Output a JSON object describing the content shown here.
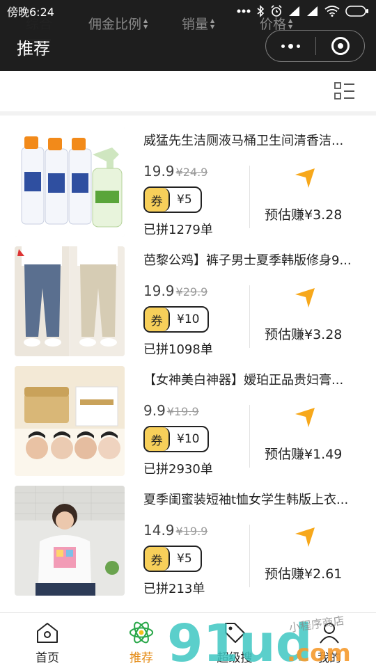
{
  "status": {
    "time": "傍晚6:24",
    "icons": [
      "dots-icon",
      "bluetooth-icon",
      "alarm-icon",
      "signal-icon",
      "signal-icon",
      "wifi-icon",
      "battery-icon"
    ]
  },
  "header": {
    "title": "推荐",
    "menu_icon": "more-dots-icon",
    "close_icon": "target-close-icon"
  },
  "sort_tabs": [
    {
      "label": "综合",
      "active": true
    },
    {
      "label": "佣金比例",
      "active": false
    },
    {
      "label": "销量",
      "active": false
    },
    {
      "label": "价格",
      "active": false
    }
  ],
  "layout_toggle_icon": "list-layout-icon",
  "coupon_label": "券",
  "products": [
    {
      "title": "威猛先生洁厕液马桶卫生间清香洁...",
      "price": "19.9",
      "old_price": "¥24.9",
      "coupon": "¥5",
      "sold": "已拼1279单",
      "earn": "预估赚¥3.28"
    },
    {
      "title": "芭黎公鸡】裤子男士夏季韩版修身9...",
      "price": "19.9",
      "old_price": "¥29.9",
      "coupon": "¥10",
      "sold": "已拼1098单",
      "earn": "预估赚¥3.28"
    },
    {
      "title": "【女神美白神器】嫒珀正品贵妇膏...",
      "price": "9.9",
      "old_price": "¥19.9",
      "coupon": "¥10",
      "sold": "已拼2930单",
      "earn": "预估赚¥1.49"
    },
    {
      "title": "夏季闺蜜装短袖t恤女学生韩版上衣...",
      "price": "14.9",
      "old_price": "¥19.9",
      "coupon": "¥5",
      "sold": "已拼213单",
      "earn": "预估赚¥2.61"
    }
  ],
  "tabbar": [
    {
      "label": "首页",
      "icon": "home-icon",
      "active": false
    },
    {
      "label": "推荐",
      "icon": "atom-icon",
      "active": true
    },
    {
      "label": "超级搜",
      "icon": "tag-icon",
      "active": false
    },
    {
      "label": "我的",
      "icon": "user-icon",
      "active": false
    }
  ],
  "watermark": {
    "brand": "91ud",
    "suffix": ".com",
    "tagline": "小程序商店"
  },
  "colors": {
    "accent": "#f7a81b",
    "coupon_bg": "#f7cf5a",
    "active_tab": "#e48a12",
    "dark_bar": "#1e1e1e",
    "watermark_teal": "#3ec7c2"
  }
}
